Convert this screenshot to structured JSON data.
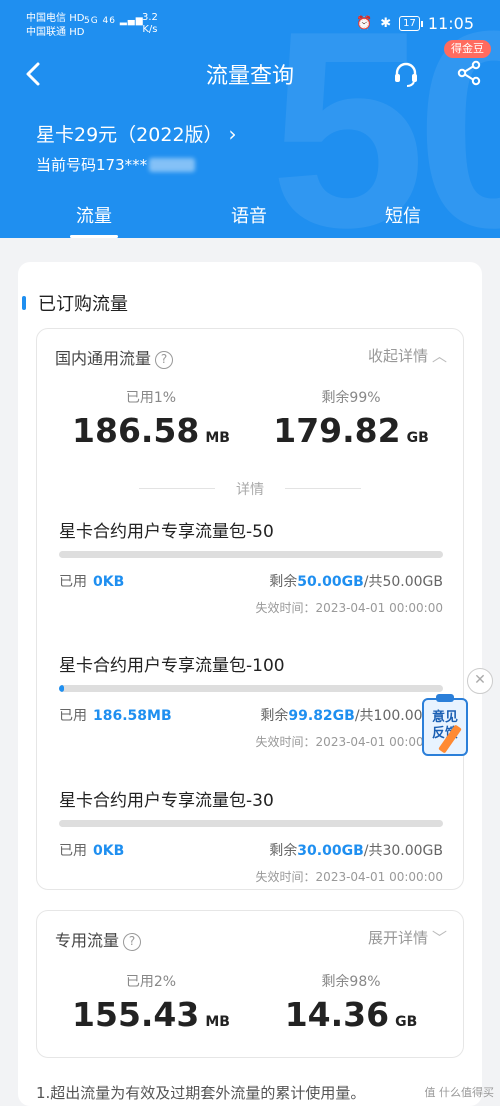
{
  "status_bar": {
    "carrier1": "中国电信",
    "carrier2": "中国联通",
    "carrier1_tag": "HD",
    "carrier2_tag": "HD",
    "signal_tag": "5G 46",
    "net_speed": "3.2",
    "net_speed_unit": "K/s",
    "battery": "17",
    "time": "11:05"
  },
  "nav": {
    "back_label": "‹",
    "title": "流量查询",
    "badge": "得金豆"
  },
  "plan": {
    "name": "星卡29元（2022版）",
    "chevron": "›",
    "phone_label": "当前号码173***"
  },
  "tabs": [
    {
      "label": "流量"
    },
    {
      "label": "语音"
    },
    {
      "label": "短信"
    }
  ],
  "main": {
    "section_title": "已订购流量",
    "domestic": {
      "title": "国内通用流量",
      "help": "?",
      "toggle": "收起详情",
      "used_label": "已用1%",
      "used_value": "186.58",
      "used_unit": "MB",
      "remain_label": "剩余99%",
      "remain_value": "179.82",
      "remain_unit": "GB",
      "details_label": "详情",
      "packages": [
        {
          "name": "星卡合约用户专享流量包-50",
          "used_prefix": "已用",
          "used": "0KB",
          "remain_prefix": "剩余",
          "remain": "50.00GB",
          "total": "/共50.00GB",
          "expire": "失效时间：2023-04-01 00:00:00",
          "progress": 0
        },
        {
          "name": "星卡合约用户专享流量包-100",
          "used_prefix": "已用",
          "used": "186.58MB",
          "remain_prefix": "剩余",
          "remain": "99.82GB",
          "total": "/共100.00GB",
          "expire": "失效时间：2023-04-01 00:00:00",
          "progress": 0.0018
        },
        {
          "name": "星卡合约用户专享流量包-30",
          "used_prefix": "已用",
          "used": "0KB",
          "remain_prefix": "剩余",
          "remain": "30.00GB",
          "total": "/共30.00GB",
          "expire": "失效时间：2023-04-01 00:00:00",
          "progress": 0
        }
      ]
    },
    "dedicated": {
      "title": "专用流量",
      "help": "?",
      "toggle": "展开详情",
      "used_label": "已用2%",
      "used_value": "155.43",
      "used_unit": "MB",
      "remain_label": "剩余98%",
      "remain_value": "14.36",
      "remain_unit": "GB"
    },
    "footnote": "1.超出流量为有效及过期套外流量的累计使用量。"
  },
  "floating": {
    "close": "✕",
    "feedback_line1": "意见",
    "feedback_line2": "反馈"
  },
  "watermark": "值 什么值得买",
  "colors": {
    "brand": "#1f8ff0",
    "badge": "#ff6b5f"
  }
}
